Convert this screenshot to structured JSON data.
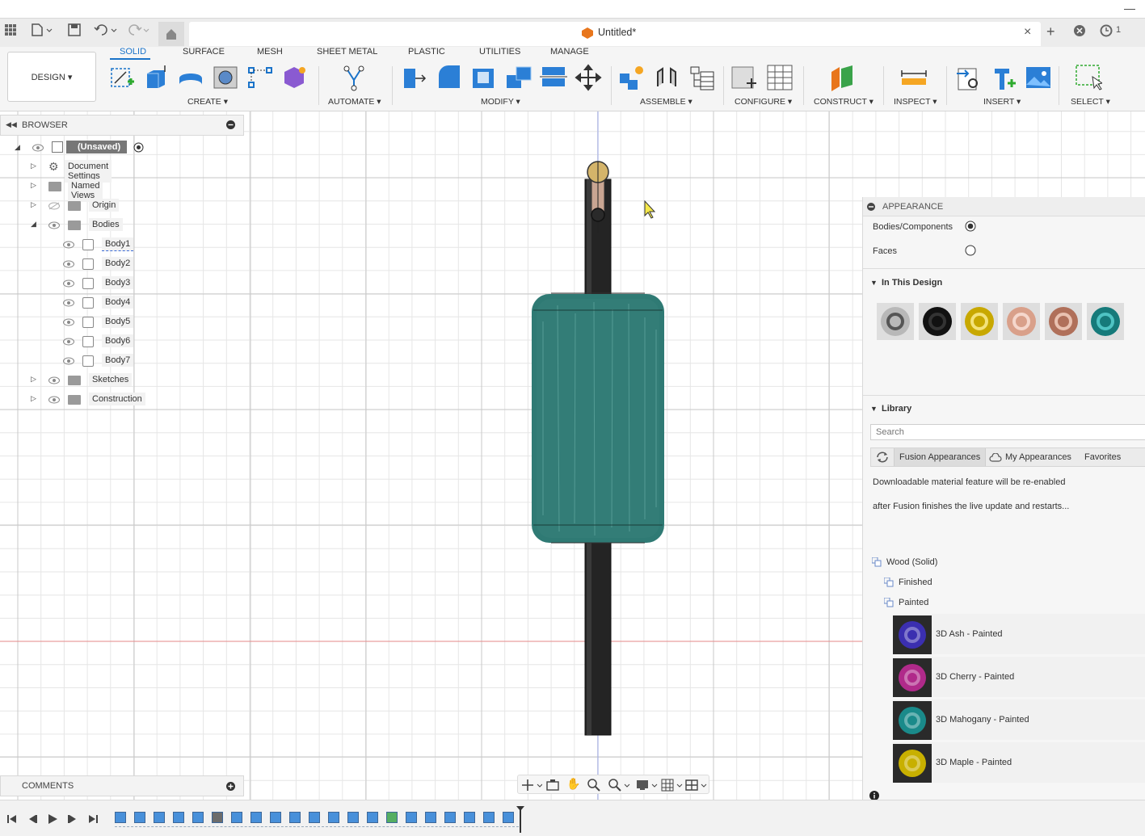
{
  "window": {
    "title": "Untitled*",
    "version_badge": "1"
  },
  "workspace": {
    "label": "DESIGN ▾"
  },
  "tabs": [
    "SOLID",
    "SURFACE",
    "MESH",
    "SHEET METAL",
    "PLASTIC",
    "UTILITIES",
    "MANAGE"
  ],
  "groups": {
    "create": "CREATE ▾",
    "automate": "AUTOMATE ▾",
    "modify": "MODIFY ▾",
    "assemble": "ASSEMBLE ▾",
    "configure": "CONFIGURE ▾",
    "construct": "CONSTRUCT ▾",
    "inspect": "INSPECT ▾",
    "insert": "INSERT ▾",
    "select": "SELECT ▾"
  },
  "browser": {
    "title": "BROWSER",
    "root": "(Unsaved)",
    "items": [
      {
        "label": "Document Settings",
        "icon": "gear-icon"
      },
      {
        "label": "Named Views",
        "icon": "folder-icon"
      },
      {
        "label": "Origin",
        "icon": "folder-icon"
      },
      {
        "label": "Bodies",
        "icon": "folder-icon"
      }
    ],
    "bodies": [
      "Body1",
      "Body2",
      "Body3",
      "Body4",
      "Body5",
      "Body6",
      "Body7"
    ],
    "tail": [
      {
        "label": "Sketches"
      },
      {
        "label": "Construction"
      }
    ]
  },
  "comments": {
    "title": "COMMENTS"
  },
  "appearance": {
    "title": "APPEARANCE",
    "apply_options": [
      "Bodies/Components",
      "Faces"
    ],
    "in_design_title": "In This Design",
    "in_design_swatches": [
      {
        "name": "chrome",
        "color": "#b8b8b8",
        "ring": "#555555"
      },
      {
        "name": "black gloss",
        "color": "#111111",
        "ring": "#333333"
      },
      {
        "name": "gold",
        "color": "#c8a800",
        "ring": "#f3e27a"
      },
      {
        "name": "rose",
        "color": "#d9a08a",
        "ring": "#f5d7cc"
      },
      {
        "name": "copper",
        "color": "#b0705a",
        "ring": "#e9c1b0"
      },
      {
        "name": "teal",
        "color": "#167a7a",
        "ring": "#4ec3c3"
      }
    ],
    "library_title": "Library",
    "search_placeholder": "Search",
    "library_tabs": [
      "Fusion Appearances",
      "My Appearances",
      "Favorites"
    ],
    "notice_1": "Downloadable material feature will be re-enabled",
    "notice_2": "after Fusion finishes the live update and restarts...",
    "tree": [
      "Wood (Solid)",
      "Finished",
      "Painted"
    ],
    "items": [
      {
        "label": "3D Ash - Painted",
        "color": "#3b2fb0"
      },
      {
        "label": "3D Cherry - Painted",
        "color": "#b02a8a"
      },
      {
        "label": "3D Mahogany - Painted",
        "color": "#1a8a8a"
      },
      {
        "label": "3D Maple - Painted",
        "color": "#c8b000"
      }
    ]
  },
  "colors": {
    "accent": "#1a73c9",
    "model_teal": "#2f7a74",
    "model_dark": "#2b2b2b"
  }
}
